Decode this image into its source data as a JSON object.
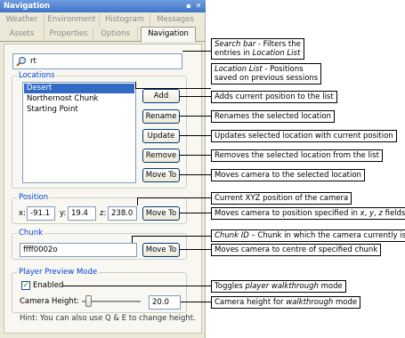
{
  "window": {
    "title": "Navigation",
    "pin_glyph": "▪",
    "close_glyph": "✕"
  },
  "tabs": {
    "row1": [
      "Weather",
      "Environment",
      "Histogram",
      "Messages"
    ],
    "row2": [
      "Assets",
      "Properties",
      "Options",
      "Navigation"
    ],
    "active": "Navigation"
  },
  "search": {
    "value": "rt",
    "icon": "search-icon"
  },
  "locations": {
    "group_title": "Locations",
    "items": [
      "Desert",
      "Northernost Chunk",
      "Starting Point"
    ],
    "selected": "Desert",
    "buttons": {
      "add": "Add",
      "rename": "Rename",
      "update": "Update",
      "remove": "Remove",
      "move_to": "Move To"
    }
  },
  "position": {
    "group_title": "Position",
    "x_label": "x:",
    "x_value": "-91.1",
    "y_label": "y:",
    "y_value": "19.4",
    "z_label": "z:",
    "z_value": "238.0",
    "move_to": "Move To"
  },
  "chunk": {
    "group_title": "Chunk",
    "value": "ffff0002o",
    "move_to": "Move To"
  },
  "preview": {
    "group_title": "Player Preview Mode",
    "enabled_label": "Enabled",
    "enabled_checked": true,
    "camera_height_label": "Camera Height:",
    "camera_height_value": "20.0",
    "hint": "Hint: You can also use Q & E to change height."
  },
  "callouts": {
    "search_bar": {
      "title": "Search bar",
      "rest": " - Filters the",
      "line2": "entries in ",
      "line2_em": "Location List"
    },
    "location_list": {
      "title": "Location List",
      "rest": " - Positions",
      "line2": "saved on previous sessions"
    },
    "add": "Adds current position to the list",
    "rename": "Renames the selected location",
    "update": "Updates selected location with current position",
    "remove": "Removes the selected location from the list",
    "move_to": "Moves camera to the selected location",
    "xyz": "Current XYZ position of the camera",
    "pos_move": {
      "text": "Moves camera to position specified in ",
      "em1": "x",
      "sep1": ", ",
      "em2": "y",
      "sep2": ", ",
      "em3": "z",
      "tail": " fields"
    },
    "chunk_id": {
      "title": "Chunk ID",
      "rest": " – Chunk in which the camera currently is"
    },
    "chunk_move": "Moves camera to centre of specified chunk",
    "walkthrough": {
      "text": "Toggles ",
      "em": "player walkthrough",
      "tail": " mode"
    },
    "camera_height": {
      "text": "Camera height for ",
      "em": "walkthrough",
      "tail": " mode"
    }
  }
}
